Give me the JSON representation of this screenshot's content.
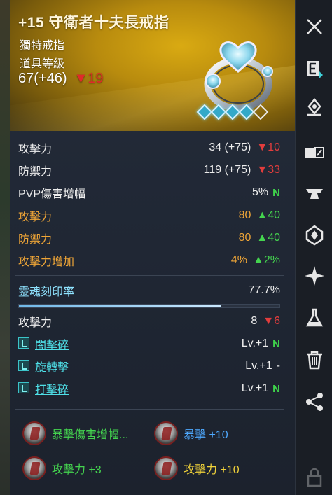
{
  "item": {
    "name": "+15 守衛者十夫長戒指",
    "type": "獨特戒指",
    "level_label": "道具等級",
    "level_value": "67(+46)",
    "level_diff": "▼19",
    "gems_filled": 4,
    "gems_total": 5
  },
  "stats": [
    {
      "label": "攻擊力",
      "value": "34 (+75)",
      "diff": "▼10",
      "label_color": "white",
      "value_color": "white",
      "diff_color": "red"
    },
    {
      "label": "防禦力",
      "value": "119 (+75)",
      "diff": "▼33",
      "label_color": "white",
      "value_color": "white",
      "diff_color": "red"
    },
    {
      "label": "PVP傷害增幅",
      "value": "5%",
      "diff": "N",
      "label_color": "white",
      "value_color": "white",
      "diff_color": "green"
    },
    {
      "label": "攻擊力",
      "value": "80",
      "diff": "▲40",
      "label_color": "orange",
      "value_color": "orange",
      "diff_color": "green"
    },
    {
      "label": "防禦力",
      "value": "80",
      "diff": "▲40",
      "label_color": "orange",
      "value_color": "orange",
      "diff_color": "green"
    },
    {
      "label": "攻擊力增加",
      "value": "4%",
      "diff": "▲2%",
      "label_color": "orange",
      "value_color": "orange",
      "diff_color": "green"
    }
  ],
  "soul": {
    "label": "靈魂刻印率",
    "value": "77.7%",
    "progress": 0.777
  },
  "soul_stat": {
    "label": "攻擊力",
    "value": "8",
    "diff": "▼6"
  },
  "skills": [
    {
      "name": "闇擊碎",
      "level": "Lv.+1",
      "diff": "N"
    },
    {
      "name": "旋轉擊",
      "level": "Lv.+1",
      "diff": "-"
    },
    {
      "name": "打擊碎",
      "level": "Lv.+1",
      "diff": "N"
    }
  ],
  "runes": [
    {
      "label": "暴擊傷害增幅...",
      "color": "green"
    },
    {
      "label": "暴擊 +10",
      "color": "blue"
    },
    {
      "label": "攻擊力 +3",
      "color": "green"
    },
    {
      "label": "攻擊力 +10",
      "color": "yellow"
    }
  ],
  "sidebar": {
    "icons": [
      "close-icon",
      "equip-e-icon",
      "waypoint-icon",
      "compare-icon",
      "anvil-icon",
      "crystal-icon",
      "sparkle-icon",
      "flask-icon",
      "trash-icon",
      "share-icon",
      "lock-icon"
    ]
  },
  "colors": {
    "orange": "#f0a637",
    "red": "#e23d3d",
    "green": "#44d44f",
    "cyan": "#4fe0e8",
    "gold_header": "#d9aa12"
  }
}
